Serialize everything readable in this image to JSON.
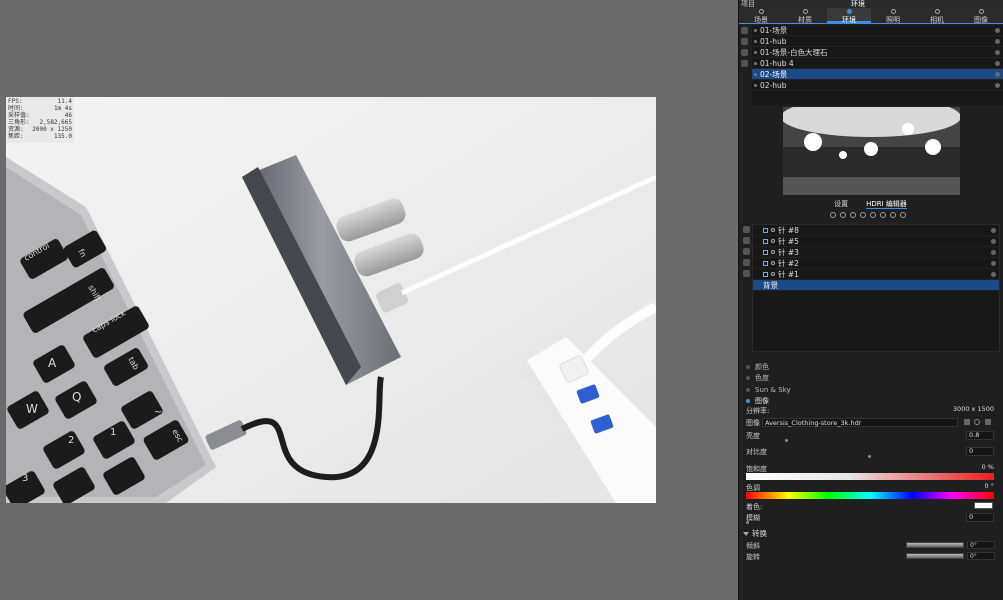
{
  "stats": [
    {
      "k": "FPS:",
      "v": "11.4"
    },
    {
      "k": "时间:",
      "v": "1m 4s"
    },
    {
      "k": "采样值:",
      "v": "46"
    },
    {
      "k": "三角形:",
      "v": "2,582,665"
    },
    {
      "k": "资源:",
      "v": "2000 x 1250"
    },
    {
      "k": "焦距:",
      "v": "135.0"
    }
  ],
  "topbar": {
    "project": "项目",
    "environment": "环境"
  },
  "tabs": [
    {
      "label": "场景",
      "icon": "scene-icon"
    },
    {
      "label": "材质",
      "icon": "material-icon"
    },
    {
      "label": "环境",
      "icon": "environment-icon"
    },
    {
      "label": "照明",
      "icon": "lighting-icon"
    },
    {
      "label": "相机",
      "icon": "camera-icon"
    },
    {
      "label": "图像",
      "icon": "image-icon"
    }
  ],
  "environments": [
    "01-场景",
    "01-hub",
    "01-场景-白色大理石",
    "01-hub 4",
    "02-场景",
    "02-hub"
  ],
  "selected_environment": "02-场景",
  "subtabs": [
    "设置",
    "HDRI 编辑器"
  ],
  "lights": [
    "针 #8",
    "针 #5",
    "针 #3",
    "针 #2",
    "针 #1",
    "背景"
  ],
  "selected_light": "背景",
  "bg_modes": [
    "颜色",
    "色度",
    "Sun & Sky",
    "图像"
  ],
  "selected_bg_mode": "图像",
  "props": {
    "resolution_label": "分辨率:",
    "resolution_value": "3000 x 1500",
    "image_label": "图像",
    "image_value": "Aversis_Clothing-store_3k.hdr",
    "brightness_label": "亮度",
    "brightness_value": "0.8",
    "contrast_label": "对比度",
    "contrast_value": "0",
    "saturation_label": "饱和度",
    "saturation_value": "0 %",
    "hue_label": "色调",
    "hue_value": "0 °",
    "tint_label": "着色:",
    "blur_label": "模糊",
    "blur_value": "0"
  },
  "transform": {
    "header": "转换",
    "tilt_label": "倾斜",
    "tilt_value": "0°",
    "rotate_label": "旋转",
    "rotate_value": "0°"
  },
  "keyboard": {
    "fn": "fn",
    "control": "control",
    "shift": "shift",
    "caps": "caps lock",
    "tab": "tab",
    "esc": "esc",
    "a": "A",
    "q": "Q",
    "w": "W",
    "num2": "2",
    "num3": "3",
    "tilde": "~",
    "num1": "1"
  },
  "colors": {
    "accent": "#3d8ee6",
    "selection": "#1c4a86",
    "panel": "#1f1f1f"
  }
}
